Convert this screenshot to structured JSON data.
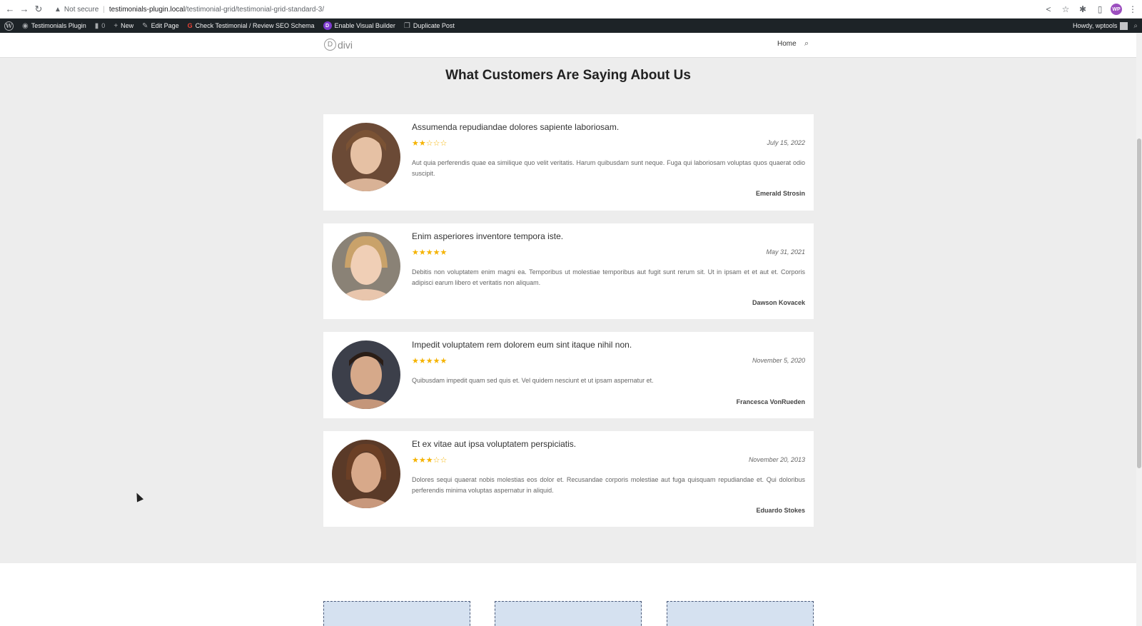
{
  "browser": {
    "security_label": "Not secure",
    "url_host": "testimonials-plugin.local",
    "url_path": "/testimonial-grid/testimonial-grid-standard-3/",
    "profile_initials": "WP"
  },
  "adminbar": {
    "site_name": "Testimonials Plugin",
    "comments_count": "0",
    "new_label": "New",
    "edit_page_label": "Edit Page",
    "seo_label": "Check Testimonial / Review SEO Schema",
    "visual_builder_label": "Enable Visual Builder",
    "duplicate_label": "Duplicate Post",
    "howdy_label": "Howdy, wptools"
  },
  "header": {
    "logo_text": "divi",
    "menu_home": "Home"
  },
  "section_title": "What Customers Are Saying About Us",
  "testimonials": [
    {
      "title": "Assumenda repudiandae dolores sapiente laboriosam.",
      "rating": 2,
      "rating_stars": "★★☆☆☆",
      "date": "July 15, 2022",
      "body": "Aut quia perferendis quae ea similique quo velit veritatis. Harum quibusdam sunt neque. Fuga qui laboriosam voluptas quos quaerat odio suscipit.",
      "author": "Emerald Strosin"
    },
    {
      "title": "Enim asperiores inventore tempora iste.",
      "rating": 5,
      "rating_stars": "★★★★★",
      "date": "May 31, 2021",
      "body": "Debitis non voluptatem enim magni ea. Temporibus ut molestiae temporibus aut fugit sunt rerum sit. Ut in ipsam et et aut et. Corporis adipisci earum libero et veritatis non aliquam.",
      "author": "Dawson Kovacek"
    },
    {
      "title": "Impedit voluptatem rem dolorem eum sint itaque nihil non.",
      "rating": 5,
      "rating_stars": "★★★★★",
      "date": "November 5, 2020",
      "body": "Quibusdam impedit quam sed quis et. Vel quidem nesciunt et ut ipsam aspernatur et.",
      "author": "Francesca VonRueden"
    },
    {
      "title": "Et ex vitae aut ipsa voluptatem perspiciatis.",
      "rating": 3,
      "rating_stars": "★★★☆☆",
      "date": "November 20, 2013",
      "body": "Dolores sequi quaerat nobis molestias eos dolor et. Recusandae corporis molestiae aut fuga quisquam repudiandae et. Qui doloribus perferendis minima voluptas aspernatur in aliquid.",
      "author": "Eduardo Stokes"
    }
  ],
  "colors": {
    "star": "#f5b301",
    "adminbar": "#1d2327",
    "page_bg": "#ededed"
  }
}
